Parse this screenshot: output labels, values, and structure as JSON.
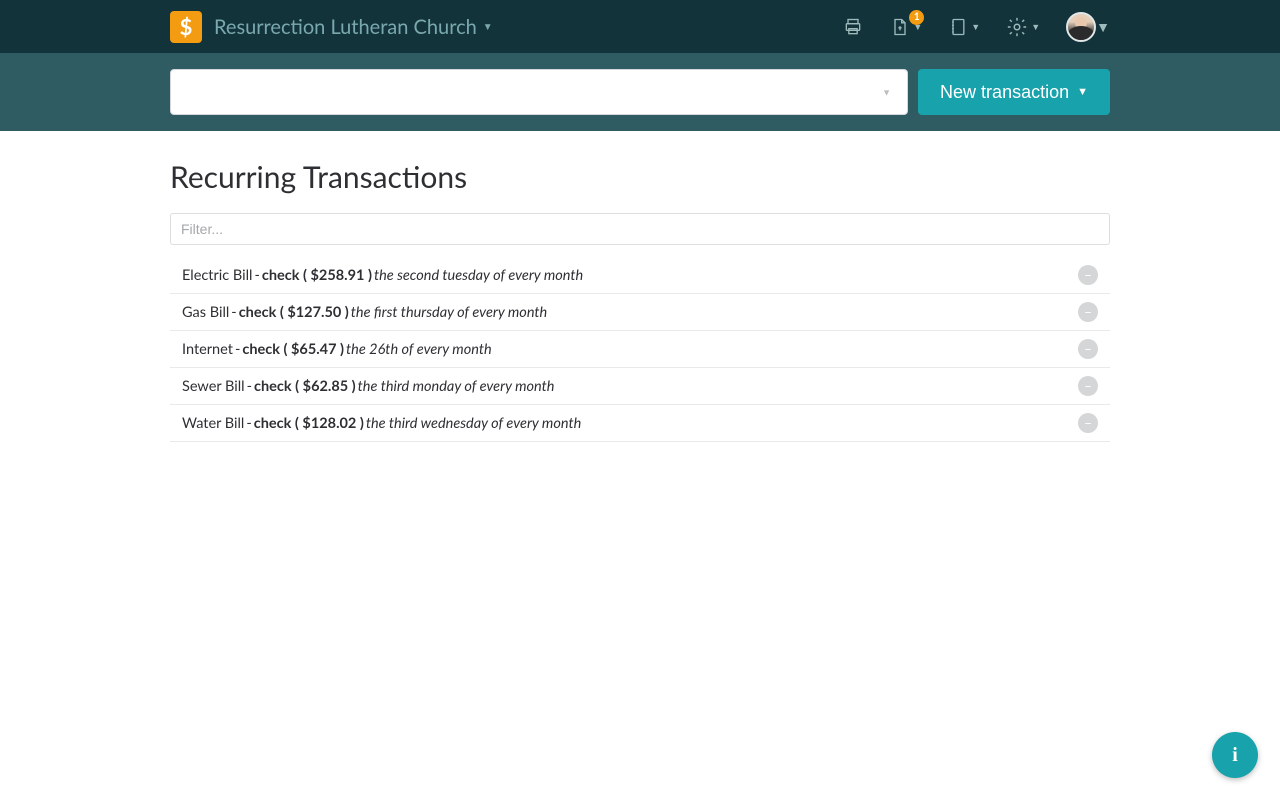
{
  "header": {
    "org_name": "Resurrection Lutheran Church",
    "notification_count": "1"
  },
  "subbar": {
    "new_transaction_label": "New transaction"
  },
  "page": {
    "title": "Recurring Transactions",
    "filter_placeholder": "Filter..."
  },
  "transactions": [
    {
      "name": "Electric Bill",
      "detail": "check ( $258.91 )",
      "schedule": "the second tuesday of every month"
    },
    {
      "name": "Gas Bill",
      "detail": "check ( $127.50 )",
      "schedule": "the first thursday of every month"
    },
    {
      "name": "Internet",
      "detail": "check ( $65.47 )",
      "schedule": "the 26th of every month"
    },
    {
      "name": "Sewer Bill",
      "detail": "check ( $62.85 )",
      "schedule": "the third monday of every month"
    },
    {
      "name": "Water Bill",
      "detail": "check ( $128.02 )",
      "schedule": "the third wednesday of every month"
    }
  ]
}
